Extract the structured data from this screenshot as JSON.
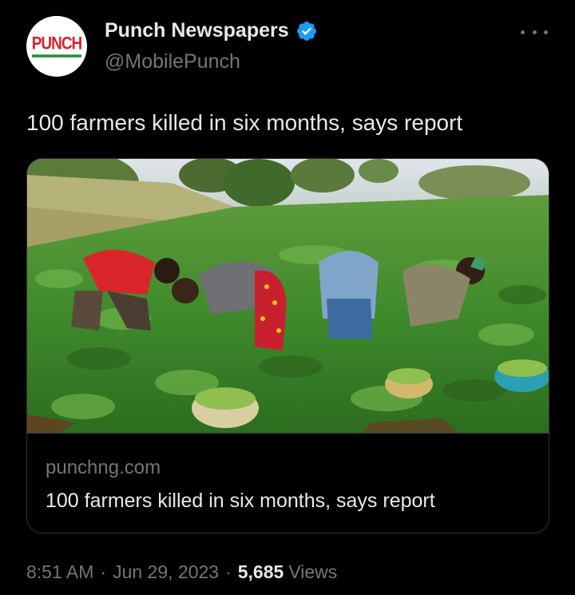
{
  "author": {
    "display_name": "Punch Newspapers",
    "handle": "@MobilePunch",
    "avatar_logo": "PUNCH",
    "verified_icon": "verified-badge-icon",
    "verified_color": "#1d9bf0"
  },
  "tweet": {
    "text": "100 farmers killed in six months, says report"
  },
  "card": {
    "domain": "punchng.com",
    "title": "100 farmers killed in six months, says report"
  },
  "footer": {
    "time": "8:51 AM",
    "separator": "·",
    "date": "Jun 29, 2023",
    "views_count": "5,685",
    "views_label": "Views"
  },
  "icons": {
    "more": "more-horizontal-icon"
  },
  "colors": {
    "background": "#000000",
    "primary_text": "#e7e9ea",
    "secondary_text": "#71767b",
    "border": "#2f3336",
    "brand_red": "#d8232a"
  }
}
